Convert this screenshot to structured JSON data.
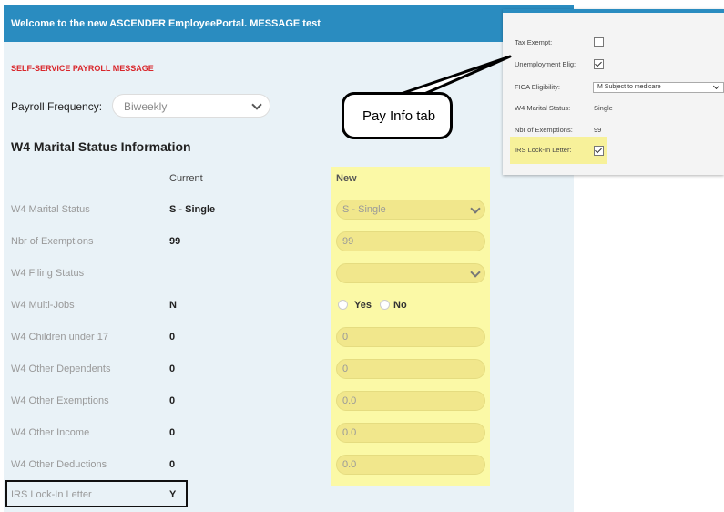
{
  "banner": {
    "text": "Welcome to the new ASCENDER EmployeePortal. MESSAGE test"
  },
  "message": {
    "text": "SELF-SERVICE PAYROLL MESSAGE"
  },
  "payroll_frequency": {
    "label": "Payroll Frequency:",
    "value": "Biweekly"
  },
  "section": {
    "title": "W4 Marital Status Information"
  },
  "columns": {
    "current": "Current",
    "new": "New"
  },
  "rows": [
    {
      "label": "W4 Marital Status",
      "current": "S - Single",
      "new": "S - Single"
    },
    {
      "label": "Nbr of Exemptions",
      "current": "99",
      "new": "99"
    },
    {
      "label": "W4 Filing Status",
      "current": "",
      "new": ""
    },
    {
      "label": "W4 Multi-Jobs",
      "current": "N",
      "yes": "Yes",
      "no": "No"
    },
    {
      "label": "W4 Children under 17",
      "current": "0",
      "new": "0"
    },
    {
      "label": "W4 Other Dependents",
      "current": "0",
      "new": "0"
    },
    {
      "label": "W4 Other Exemptions",
      "current": "0",
      "new": "0.0"
    },
    {
      "label": "W4 Other Income",
      "current": "0",
      "new": "0.0"
    },
    {
      "label": "W4 Other Deductions",
      "current": "0",
      "new": "0.0"
    },
    {
      "label": "IRS Lock-In Letter",
      "current": "Y"
    }
  ],
  "inset": {
    "tax_exempt": "Tax Exempt:",
    "unemployment_elig": "Unemployment Elig:",
    "fica_eligibility": "FICA Eligibility:",
    "fica_value": "M Subject to medicare",
    "w4_marital_status": "W4 Marital Status:",
    "w4_marital_value": "Single",
    "nbr_exemptions": "Nbr of Exemptions:",
    "nbr_exemptions_value": "99",
    "irs_lock_in": "IRS Lock-In Letter:"
  },
  "callout": {
    "text": "Pay Info tab"
  },
  "colors": {
    "banner": "#2a8cc0",
    "message": "#d9262b",
    "highlight": "#fbf9a6"
  }
}
